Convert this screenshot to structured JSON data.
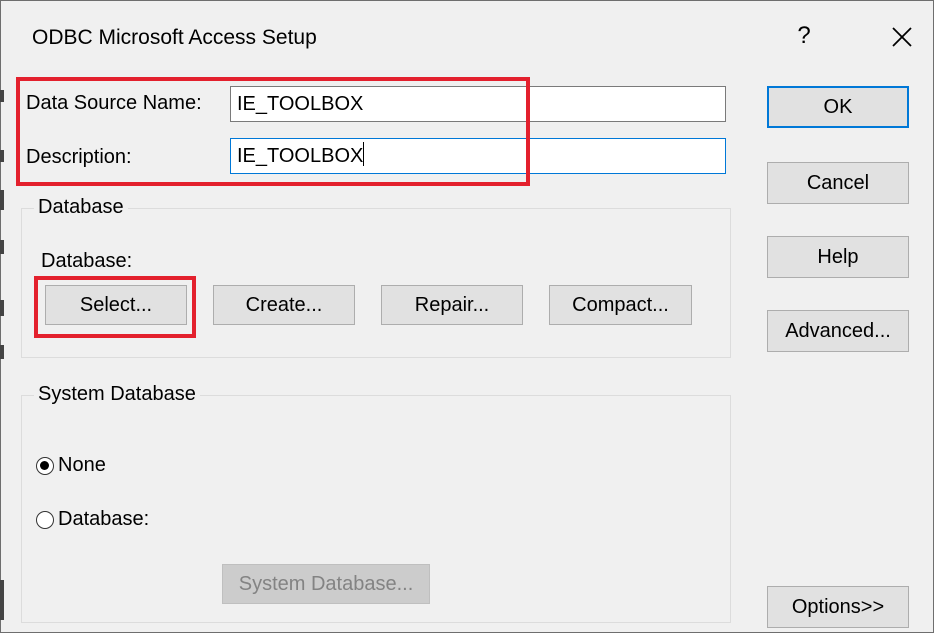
{
  "dialog": {
    "title": "ODBC Microsoft Access Setup",
    "help_glyph": "?",
    "close_icon": "close-icon"
  },
  "fields": {
    "dsn_label": "Data Source Name:",
    "dsn_value": "IE_TOOLBOX",
    "description_label": "Description:",
    "description_value": "IE_TOOLBOX"
  },
  "side_buttons": {
    "ok": "OK",
    "cancel": "Cancel",
    "help": "Help",
    "advanced": "Advanced...",
    "options": "Options>>"
  },
  "database_group": {
    "title": "Database",
    "label": "Database:",
    "select": "Select...",
    "create": "Create...",
    "repair": "Repair...",
    "compact": "Compact..."
  },
  "system_db_group": {
    "title": "System Database",
    "none_label": "None",
    "database_label": "Database:",
    "selected": "None",
    "system_db_button": "System Database..."
  },
  "annotation_color": "#e3202d"
}
